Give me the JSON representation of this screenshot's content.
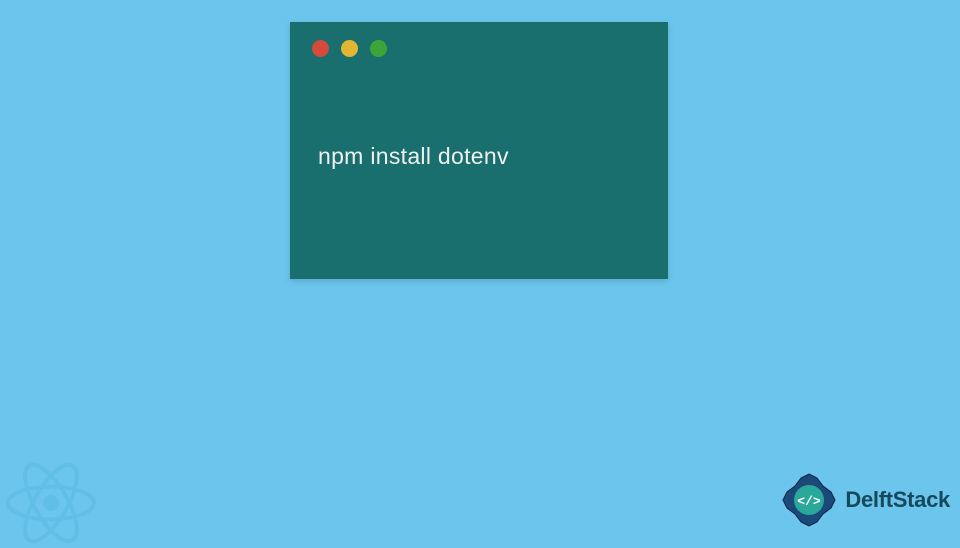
{
  "terminal": {
    "command": "npm install dotenv"
  },
  "branding": {
    "name": "DelftStack"
  },
  "colors": {
    "background": "#6cc5ed",
    "terminal_bg": "#196e6e",
    "dot_red": "#d54a3b",
    "dot_yellow": "#e2b633",
    "dot_green": "#3fa438",
    "brand_text": "#144a5a"
  }
}
